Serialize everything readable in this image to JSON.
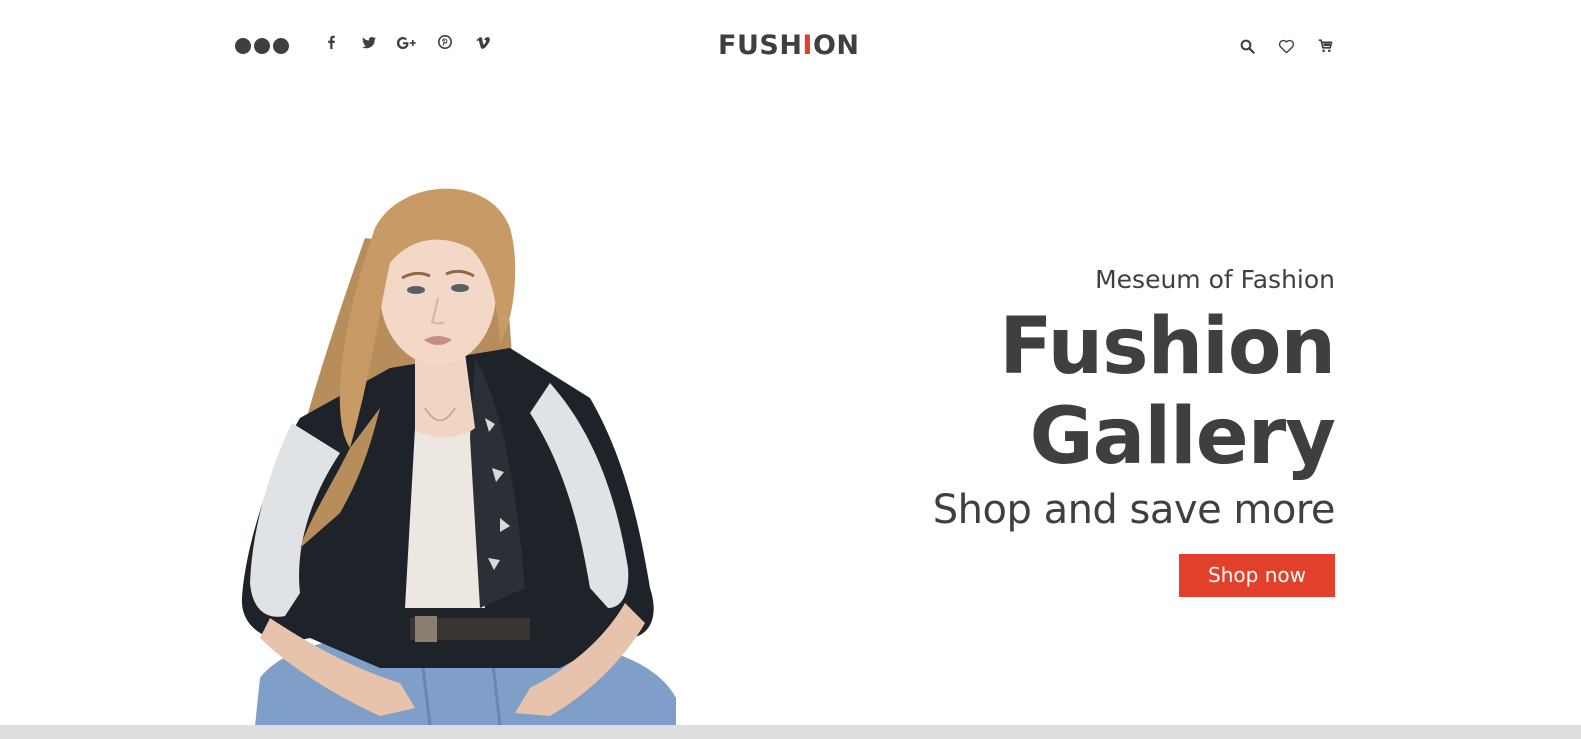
{
  "header": {
    "menu_icon": "three-dots-icon",
    "social": [
      {
        "name": "facebook-icon",
        "glyph": "f"
      },
      {
        "name": "twitter-icon",
        "glyph": "t"
      },
      {
        "name": "google-plus-icon",
        "glyph": "G+"
      },
      {
        "name": "pinterest-icon",
        "glyph": "p"
      },
      {
        "name": "vimeo-icon",
        "glyph": "v"
      }
    ],
    "logo": {
      "before": "FUSH",
      "accent": "I",
      "after": "ON"
    },
    "tools": [
      "search-icon",
      "heart-icon",
      "cart-icon"
    ]
  },
  "hero": {
    "kicker": "Meseum of Fashion",
    "headline_line1": "Fushion",
    "headline_line2": "Gallery",
    "subhead": "Shop and save more",
    "cta_label": "Shop now"
  },
  "colors": {
    "text": "#3f3f3f",
    "accent": "#e2402a",
    "background": "#ffffff",
    "strip": "#dddddd"
  }
}
